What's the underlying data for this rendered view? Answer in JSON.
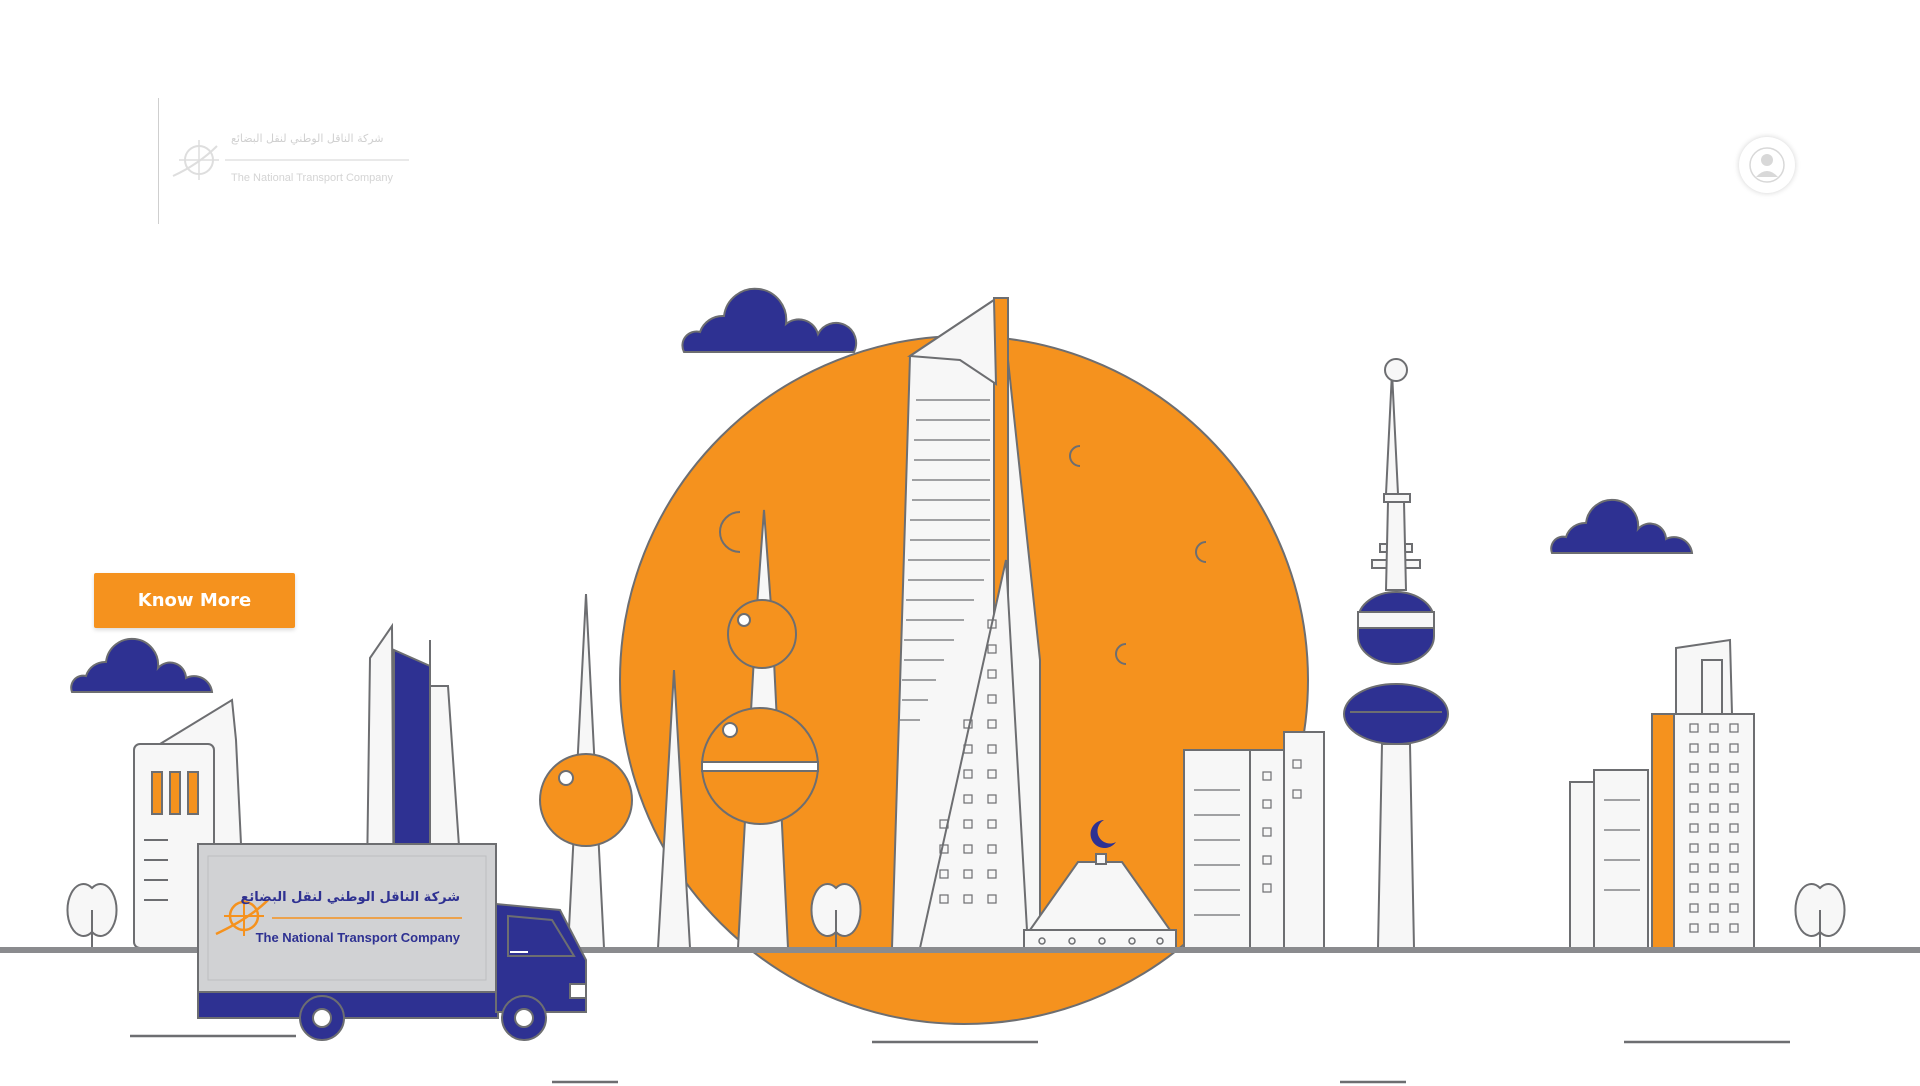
{
  "header": {
    "logo": {
      "arabic_text": "شركة الناقل الوطني لنقل البضائع",
      "english_text": "The National Transport Company"
    },
    "user_icon": "user-icon"
  },
  "hero": {
    "cta_label": "Know More"
  },
  "truck": {
    "logo_arabic": "شركة الناقل الوطني لنقل البضائع",
    "logo_english": "The National Transport Company"
  },
  "colors": {
    "accent_orange": "#f5921e",
    "navy": "#2e3192",
    "outline_gray": "#6d6e71",
    "building_fill": "#f7f7f7"
  }
}
